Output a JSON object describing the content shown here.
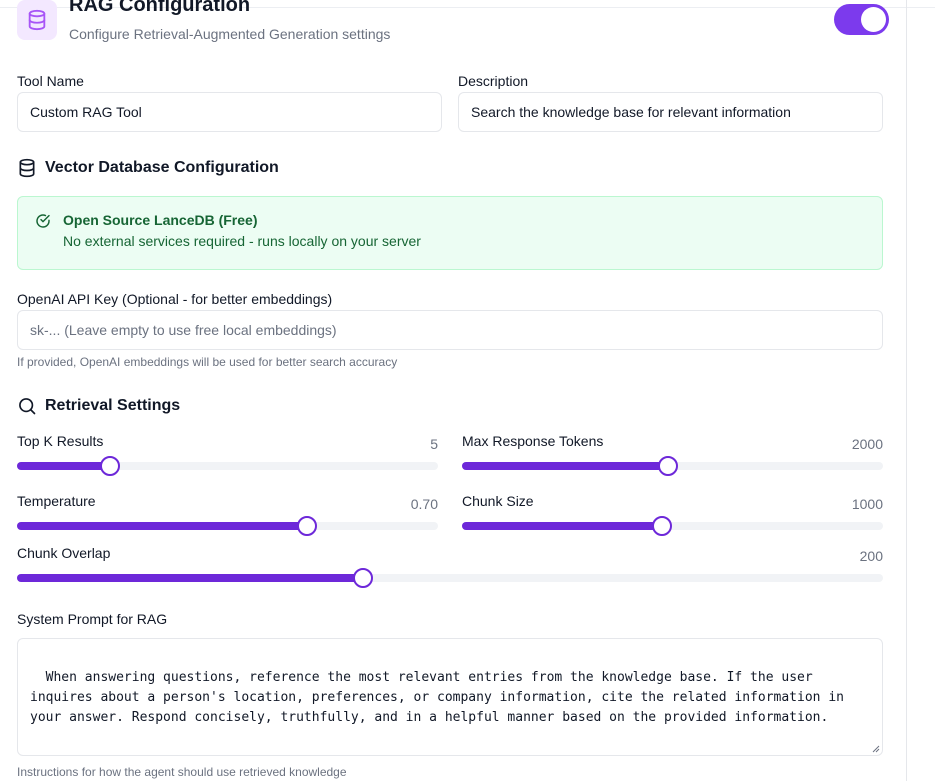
{
  "header": {
    "title": "RAG Configuration",
    "subtitle": "Configure Retrieval-Augmented Generation settings",
    "icon": "database-icon",
    "enabled": true
  },
  "tool": {
    "name_label": "Tool Name",
    "name_value": "Custom RAG Tool",
    "description_label": "Description",
    "description_value": "Search the knowledge base for relevant information"
  },
  "vector_db": {
    "section_title": "Vector Database Configuration",
    "info_title": "Open Source LanceDB (Free)",
    "info_desc": "No external services required - runs locally on your server",
    "api_key_label": "OpenAI API Key (Optional - for better embeddings)",
    "api_key_value": "",
    "api_key_placeholder": "sk-... (Leave empty to use free local embeddings)",
    "api_key_hint": "If provided, OpenAI embeddings will be used for better search accuracy"
  },
  "retrieval": {
    "section_title": "Retrieval Settings",
    "sliders": [
      {
        "label": "Top K Results",
        "value": "5",
        "fraction": 0.222
      },
      {
        "label": "Max Response Tokens",
        "value": "2000",
        "fraction": 0.49
      },
      {
        "label": "Temperature",
        "value": "0.70",
        "fraction": 0.69
      },
      {
        "label": "Chunk Size",
        "value": "1000",
        "fraction": 0.474
      },
      {
        "label": "Chunk Overlap",
        "value": "200",
        "fraction": 0.4
      }
    ]
  },
  "system_prompt": {
    "label": "System Prompt for RAG",
    "value": "When answering questions, reference the most relevant entries from the knowledge base. If the user inquires about a person's location, preferences, or company information, cite the related information in your answer. Respond concisely, truthfully, and in a helpful manner based on the provided information.",
    "hint": "Instructions for how the agent should use retrieved knowledge"
  },
  "colors": {
    "accent": "#6d28d9",
    "toggle": "#7c3aed",
    "success_bg": "#ecfdf3",
    "success_text": "#166534"
  }
}
